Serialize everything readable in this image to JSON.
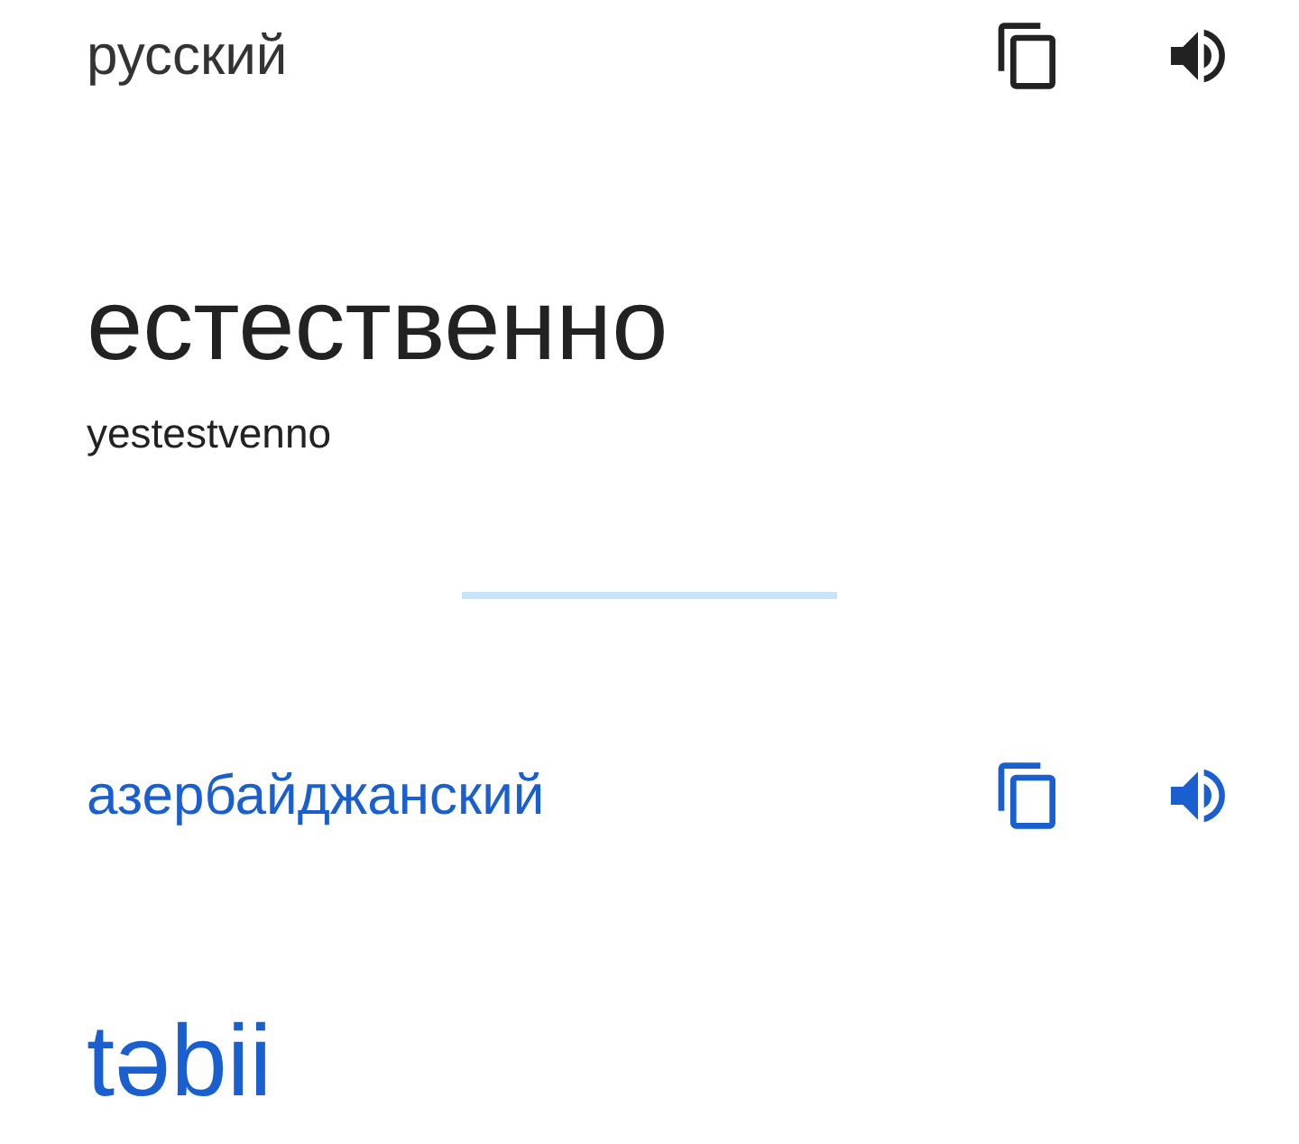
{
  "source": {
    "language": "русский",
    "text": "естественно",
    "transliteration": "yestestvenno"
  },
  "target": {
    "language": "азербайджанский",
    "text": "təbii"
  }
}
